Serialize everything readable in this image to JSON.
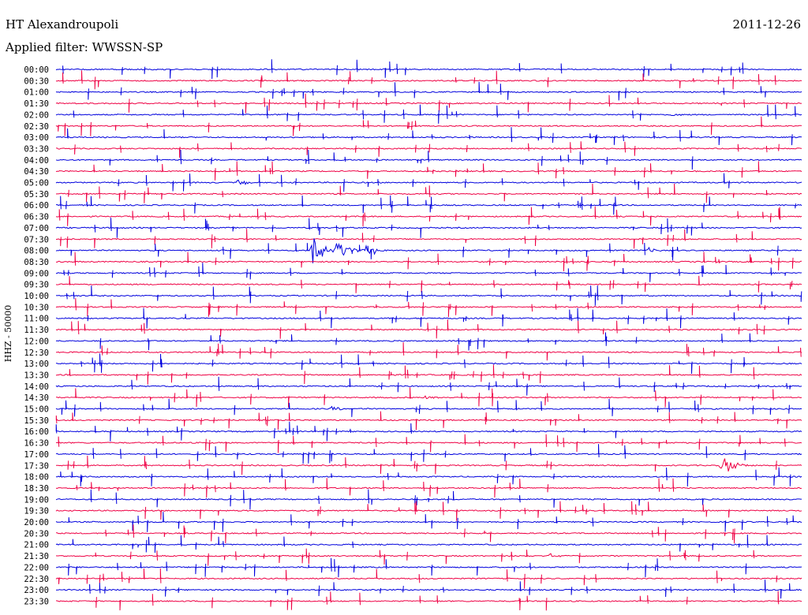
{
  "header": {
    "station": "HT Alexandroupoli",
    "filter": "Applied filter: WWSSN-SP",
    "date": "2011-12-26"
  },
  "colors": {
    "even_trace": "#0000dd",
    "odd_trace": "#ee0044",
    "text": "#000000",
    "background": "#ffffff"
  },
  "chart_data": {
    "type": "line",
    "title": "HT Alexandroupoli",
    "subtitle": "Applied filter: WWSSN-SP",
    "date": "2011-12-26",
    "ylabel": "HHZ - 50000",
    "xlabel": "",
    "trace_labels": [
      "00:00",
      "00:30",
      "01:00",
      "01:30",
      "02:00",
      "02:30",
      "03:00",
      "03:30",
      "04:00",
      "04:30",
      "05:00",
      "05:30",
      "06:00",
      "06:30",
      "07:00",
      "07:30",
      "08:00",
      "08:30",
      "09:00",
      "09:30",
      "10:00",
      "10:30",
      "11:00",
      "11:30",
      "12:00",
      "12:30",
      "13:00",
      "13:30",
      "14:00",
      "14:30",
      "15:00",
      "15:30",
      "16:00",
      "16:30",
      "17:00",
      "17:30",
      "18:00",
      "18:30",
      "19:00",
      "19:30",
      "20:00",
      "20:30",
      "21:00",
      "21:30",
      "22:00",
      "22:30",
      "23:00",
      "23:30"
    ],
    "trace_colors": [
      "#0000dd",
      "#ee0044"
    ],
    "trace_minutes": 30,
    "events": [
      {
        "trace": "05:00",
        "minute_start": 7.2,
        "minute_end": 8.8,
        "amplitude": 0.35
      },
      {
        "trace": "08:00",
        "minute_start": 10.2,
        "minute_end": 11.2,
        "amplitude": 3.0
      },
      {
        "trace": "08:00",
        "minute_start": 11.2,
        "minute_end": 12.5,
        "amplitude": 1.2
      },
      {
        "trace": "08:00",
        "minute_start": 12.5,
        "minute_end": 13.3,
        "amplitude": 0.5
      },
      {
        "trace": "08:00",
        "minute_start": 12.4,
        "minute_end": 13.2,
        "amplitude": 0.7
      },
      {
        "trace": "08:00",
        "minute_start": 23.8,
        "minute_end": 24.5,
        "amplitude": 0.3
      },
      {
        "trace": "15:00",
        "minute_start": 11.0,
        "minute_end": 12.3,
        "amplitude": 0.25
      },
      {
        "trace": "17:30",
        "minute_start": 26.7,
        "minute_end": 28.0,
        "amplitude": 1.3
      },
      {
        "trace": "21:30",
        "minute_start": 19.8,
        "minute_end": 20.6,
        "amplitude": 0.25
      },
      {
        "trace": "02:00",
        "minute_start": 24.7,
        "minute_end": 25.4,
        "amplitude": 0.2
      },
      {
        "trace": "14:30",
        "minute_start": 14.8,
        "minute_end": 15.8,
        "amplitude": 0.2
      }
    ],
    "grid": false,
    "legend": "none"
  }
}
